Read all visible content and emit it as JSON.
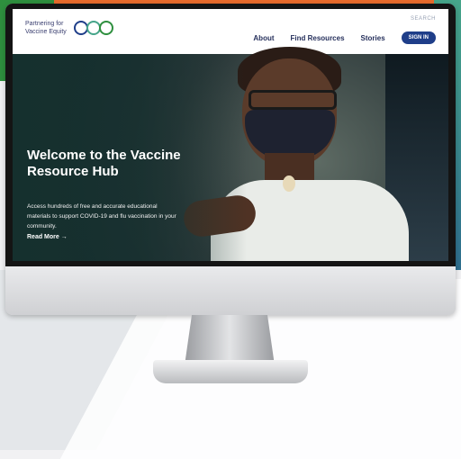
{
  "header": {
    "logo_text": "Partnering for Vaccine Equity",
    "util_link": "SEARCH",
    "nav": [
      {
        "label": "About"
      },
      {
        "label": "Find Resources"
      },
      {
        "label": "Stories"
      }
    ],
    "signin_label": "SIGN IN"
  },
  "hero": {
    "title": "Welcome to the Vaccine Resource Hub",
    "description": "Access hundreds of free and accurate educational materials to support COVID-19 and flu vaccination in your community.",
    "read_more": "Read More →"
  },
  "colors": {
    "brand_navy": "#1f3e89",
    "brand_green": "#2e8f3e",
    "accent_orange": "#e96b2c"
  }
}
